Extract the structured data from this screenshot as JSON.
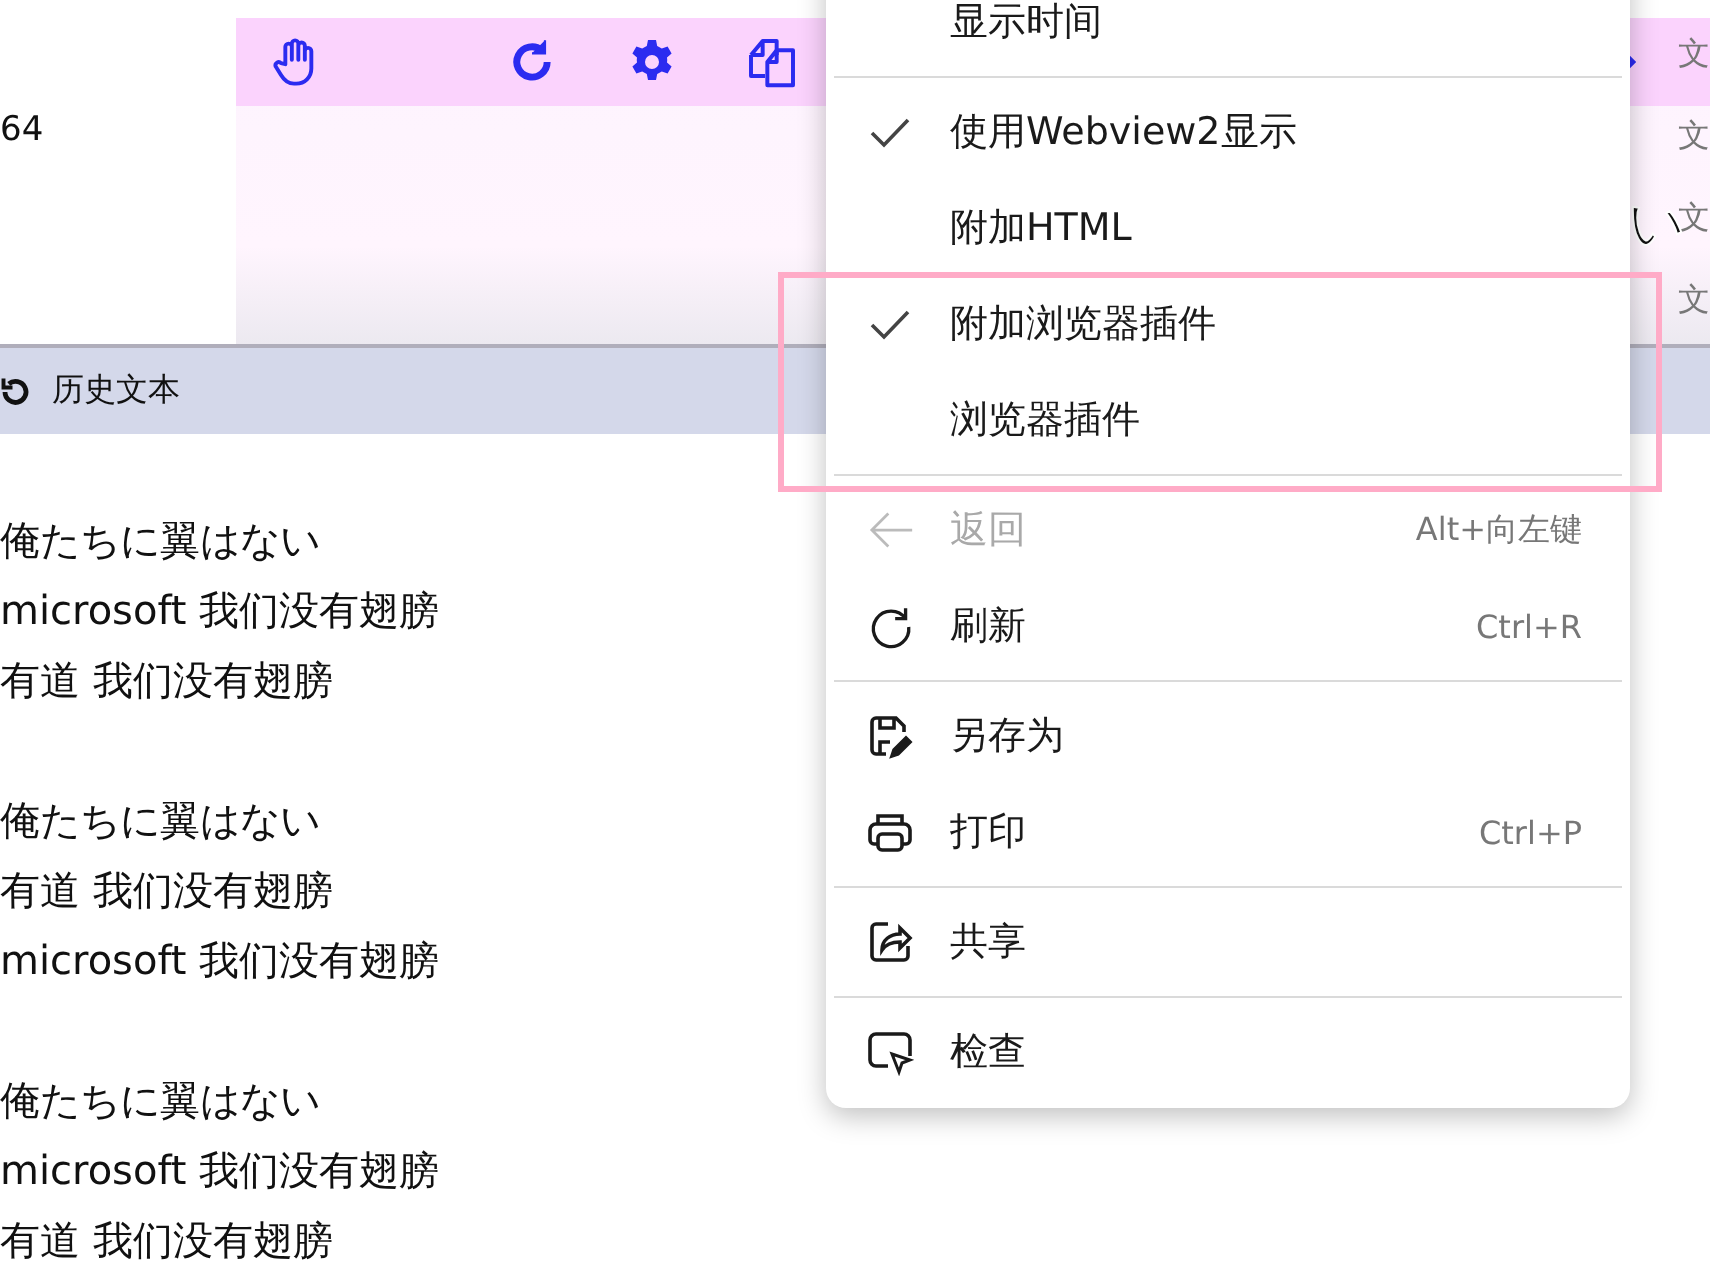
{
  "left_text": "64",
  "side_column": [
    "文",
    "文",
    "文",
    "文"
  ],
  "overlay_text": "い",
  "history_bar": {
    "label": "历史文本"
  },
  "history_groups": [
    [
      "俺たちに翼はない",
      "microsoft 我们没有翅膀",
      "有道 我们没有翅膀"
    ],
    [
      "俺たちに翼はない",
      "有道 我们没有翅膀",
      "microsoft 我们没有翅膀"
    ],
    [
      "俺たちに翼はない",
      "microsoft 我们没有翅膀",
      "有道 我们没有翅膀"
    ]
  ],
  "context_menu": {
    "items": [
      {
        "kind": "check",
        "label": "显示时间",
        "checked": false
      },
      {
        "kind": "divider"
      },
      {
        "kind": "check",
        "label": "使用Webview2显示",
        "checked": true
      },
      {
        "kind": "check",
        "label": "附加HTML",
        "checked": false
      },
      {
        "kind": "check",
        "label": "附加浏览器插件",
        "checked": true
      },
      {
        "kind": "check",
        "label": "浏览器插件",
        "checked": false
      },
      {
        "kind": "divider"
      },
      {
        "kind": "action",
        "label": "返回",
        "shortcut": "Alt+向左键",
        "disabled": true
      },
      {
        "kind": "action",
        "label": "刷新",
        "shortcut": "Ctrl+R",
        "disabled": false
      },
      {
        "kind": "divider"
      },
      {
        "kind": "action",
        "label": "另存为",
        "disabled": false
      },
      {
        "kind": "action",
        "label": "打印",
        "shortcut": "Ctrl+P",
        "disabled": false
      },
      {
        "kind": "divider"
      },
      {
        "kind": "action",
        "label": "共享",
        "disabled": false
      },
      {
        "kind": "divider"
      },
      {
        "kind": "action",
        "label": "检查",
        "disabled": false
      }
    ]
  },
  "highlight": {
    "shown": true
  }
}
